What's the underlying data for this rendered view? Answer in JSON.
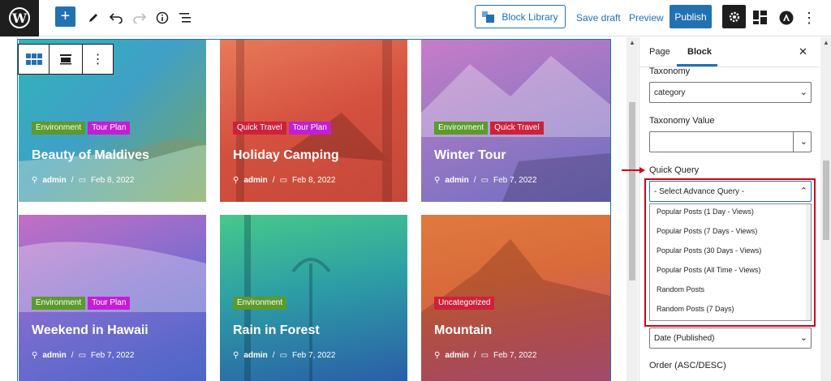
{
  "toolbar": {
    "block_library": "Block Library",
    "save_draft": "Save draft",
    "preview": "Preview",
    "publish": "Publish"
  },
  "cards": [
    {
      "tags": [
        {
          "label": "Environment",
          "color": "#5b9a2b"
        },
        {
          "label": "Tour Plan",
          "color": "#c21fd4"
        }
      ],
      "title": "Beauty of Maldives",
      "author": "admin",
      "date": "Feb 8, 2022"
    },
    {
      "tags": [
        {
          "label": "Quick Travel",
          "color": "#d0213a"
        },
        {
          "label": "Tour Plan",
          "color": "#c21fd4"
        }
      ],
      "title": "Holiday Camping",
      "author": "admin",
      "date": "Feb 8, 2022"
    },
    {
      "tags": [
        {
          "label": "Environment",
          "color": "#5b9a2b"
        },
        {
          "label": "Quick Travel",
          "color": "#d0213a"
        }
      ],
      "title": "Winter Tour",
      "author": "admin",
      "date": "Feb 7, 2022"
    },
    {
      "tags": [
        {
          "label": "Environment",
          "color": "#5b9a2b"
        },
        {
          "label": "Tour Plan",
          "color": "#c21fd4"
        }
      ],
      "title": "Weekend in Hawaii",
      "author": "admin",
      "date": "Feb 7, 2022"
    },
    {
      "tags": [
        {
          "label": "Environment",
          "color": "#5b9a2b"
        }
      ],
      "title": "Rain in Forest",
      "author": "admin",
      "date": "Feb 7, 2022"
    },
    {
      "tags": [
        {
          "label": "Uncategorized",
          "color": "#d0213a"
        }
      ],
      "title": "Mountain",
      "author": "admin",
      "date": "Feb 7, 2022"
    }
  ],
  "sidebar": {
    "tab_page": "Page",
    "tab_block": "Block",
    "taxonomy_label": "Taxonomy",
    "taxonomy_value": "category",
    "taxonomy_value_label": "Taxonomy Value",
    "quick_query_label": "Quick Query",
    "quick_query_value": "- Select Advance Query -",
    "dropdown_options": [
      "Popular Posts (1 Day - Views)",
      "Popular Posts (7 Days - Views)",
      "Popular Posts (30 Days - Views)",
      "Popular Posts (All Time - Views)",
      "Random Posts",
      "Random Posts (7 Days)"
    ],
    "order_by_value": "Date (Published)",
    "order_label": "Order (ASC/DESC)"
  },
  "colors": {
    "accent": "#2271b1",
    "highlight": "#d0021b"
  }
}
